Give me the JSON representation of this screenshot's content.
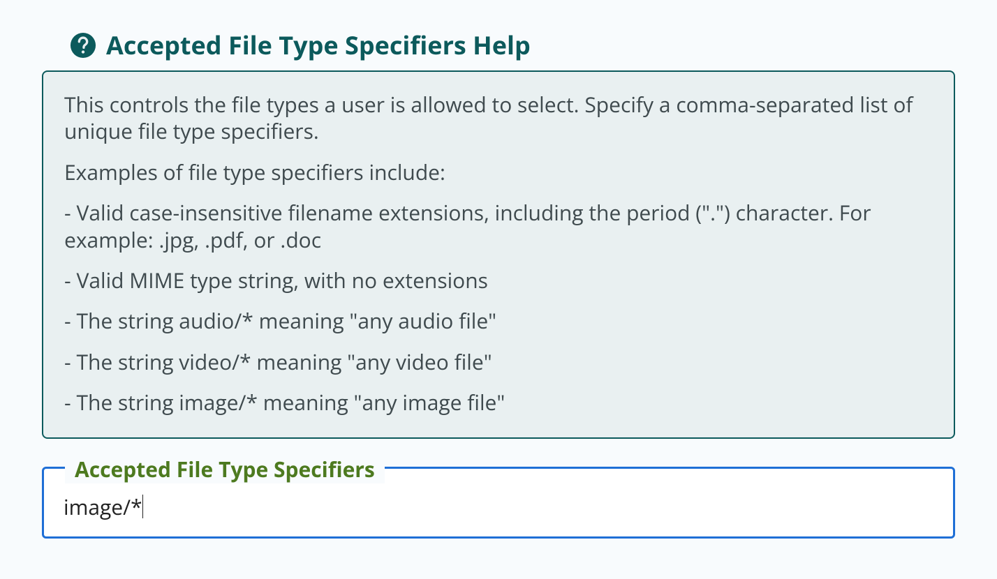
{
  "header": {
    "title": "Accepted File Type Specifiers Help"
  },
  "help": {
    "intro": "This controls the file types a user is allowed to select. Specify a comma-separated list of unique file type specifiers.",
    "examples_lead": "Examples of file type specifiers include:",
    "bullet1": "- Valid case-insensitive filename extensions, including the period (\".\") character. For example: .jpg, .pdf, or .doc",
    "bullet2": "- Valid MIME type string, with no extensions",
    "bullet3": "- The string audio/* meaning \"any audio file\"",
    "bullet4": "- The string video/* meaning \"any video file\"",
    "bullet5": "- The string image/* meaning \"any image file\""
  },
  "field": {
    "legend": "Accepted File Type Specifiers",
    "value": "image/*"
  }
}
